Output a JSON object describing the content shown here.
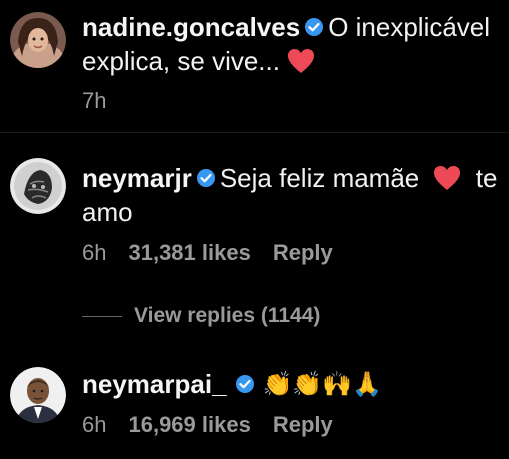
{
  "comments": [
    {
      "username": "nadine.goncalves",
      "line1": "O inexplicável",
      "line2": "explica, se vive...",
      "time": "7h",
      "verified": true
    },
    {
      "username": "neymarjr",
      "line1": "Seja feliz mamãe",
      "line1_tail": "te",
      "line2": "amo",
      "time": "6h",
      "likes": "31,381 likes",
      "reply": "Reply",
      "view_replies": "View replies (1144)",
      "verified": true
    },
    {
      "username": "neymarpai_",
      "emoji_text": "👏👏🙌🙏",
      "time": "6h",
      "likes": "16,969 likes",
      "reply": "Reply",
      "verified": true
    }
  ],
  "colors": {
    "background": "#000000",
    "text": "#f2f2f2",
    "meta": "#9a9a9a",
    "verified": "#3897f0",
    "heart": "#ed4956"
  }
}
